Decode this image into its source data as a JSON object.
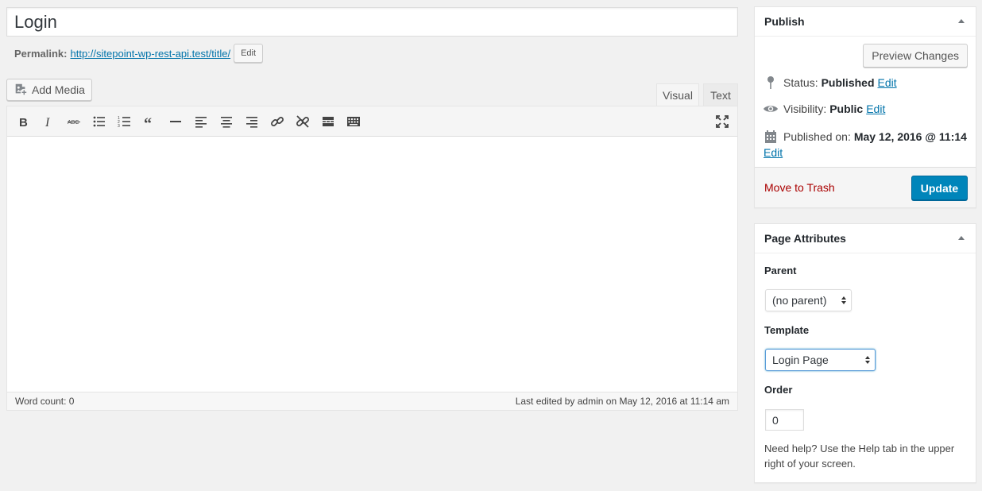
{
  "title": {
    "value": "Login"
  },
  "permalink": {
    "label": "Permalink:",
    "url": "http://sitepoint-wp-rest-api.test/title/",
    "edit_label": "Edit"
  },
  "media": {
    "add_label": "Add Media"
  },
  "editor": {
    "tabs": {
      "visual": "Visual",
      "text": "Text"
    },
    "active_tab": "Visual",
    "toolbar_icons": [
      "bold-icon",
      "italic-icon",
      "strikethrough-icon",
      "bulleted-list-icon",
      "numbered-list-icon",
      "blockquote-icon",
      "horizontal-line-icon",
      "align-left-icon",
      "align-center-icon",
      "align-right-icon",
      "insert-link-icon",
      "remove-link-icon",
      "read-more-icon",
      "toolbar-toggle-icon",
      "fullscreen-icon"
    ],
    "word_count": "Word count: 0",
    "last_edited": "Last edited by admin on May 12, 2016 at 11:14 am"
  },
  "publish": {
    "heading": "Publish",
    "preview_label": "Preview Changes",
    "status_label": "Status:",
    "status_value": "Published",
    "visibility_label": "Visibility:",
    "visibility_value": "Public",
    "published_label": "Published on:",
    "published_value": "May 12, 2016 @ 11:14",
    "edit_label": "Edit",
    "trash_label": "Move to Trash",
    "update_label": "Update"
  },
  "attributes": {
    "heading": "Page Attributes",
    "parent_label": "Parent",
    "parent_value": "(no parent)",
    "template_label": "Template",
    "template_value": "Login Page",
    "order_label": "Order",
    "order_value": "0",
    "help_text": "Need help? Use the Help tab in the upper right of your screen."
  },
  "colors": {
    "primary": "#0085ba",
    "link": "#0073aa",
    "trash": "#a00",
    "background": "#f1f1f1"
  }
}
